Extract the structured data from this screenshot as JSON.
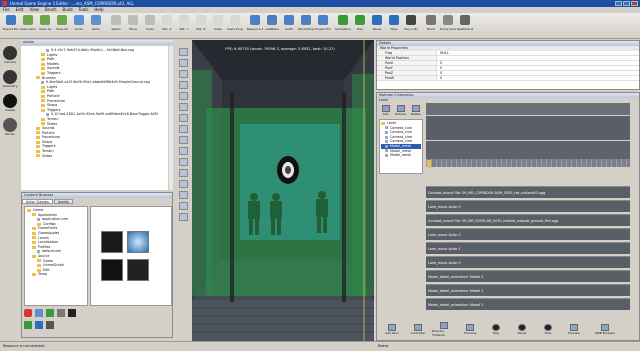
{
  "window": {
    "title": "Unreal Game Engine 3 Editor - ...vio_ASM_CORRIDOR.ut3, ALL"
  },
  "menu": [
    "File",
    "Edit",
    "View",
    "Brush",
    "Build",
    "Tools",
    "Help"
  ],
  "toolbar": [
    {
      "label": "Export Browser",
      "color": "#3f7bbf"
    },
    {
      "label": "Save Game",
      "color": "#6aa84f"
    },
    {
      "label": "Save As",
      "color": "#6aa84f"
    },
    {
      "label": "Save All",
      "color": "#6aa84f"
    },
    {
      "label": "Undo",
      "color": "#5b8fd6"
    },
    {
      "label": "Redo",
      "color": "#5b8fd6"
    },
    {
      "label": "Select",
      "color": "#bcbcbc"
    },
    {
      "label": "Move",
      "color": "#bcbcbc"
    },
    {
      "label": "Scale",
      "color": "#bcbcbc"
    },
    {
      "label": "Rot. X",
      "color": "#d8d8d8"
    },
    {
      "label": "Rot. Y",
      "color": "#d8d8d8"
    },
    {
      "label": "Rot. Z",
      "color": "#d8d8d8"
    },
    {
      "label": "Scale",
      "color": "#d8d8d8"
    },
    {
      "label": "Scale Proportional",
      "color": "#d8d8d8"
    },
    {
      "label": "Resource Browser",
      "color": "#4d7fc4"
    },
    {
      "label": "LastBake",
      "color": "#4d7fc4"
    },
    {
      "label": "AnIM",
      "color": "#4d7fc4"
    },
    {
      "label": "World Props",
      "color": "#4d7fc4"
    },
    {
      "label": "Project Props",
      "color": "#4d7fc4"
    },
    {
      "label": "Simulation",
      "color": "#3c9a3c"
    },
    {
      "label": "Play",
      "color": "#3c9a3c"
    },
    {
      "label": "Pause",
      "color": "#2c6fbf"
    },
    {
      "label": "Stop",
      "color": "#2c6fbf"
    },
    {
      "label": "Play (CE)",
      "color": "#444"
    },
    {
      "label": "Build",
      "color": "#777"
    },
    {
      "label": "Prune Scene",
      "color": "#888"
    },
    {
      "label": "Realtime Render",
      "color": "#666"
    }
  ],
  "left_icons": [
    {
      "label": "Camera",
      "color": "#333"
    },
    {
      "label": "Geometry",
      "color": "#333"
    },
    {
      "label": "Create",
      "color": "#111"
    },
    {
      "label": "Terrain",
      "color": "#555"
    }
  ],
  "actors": {
    "title": "Actors",
    "items": [
      {
        "label": "0.4 c5c7-9eb37d-4b0c-9fa4e1-...5e16b6.Box.csg",
        "kind": "file",
        "depth": 3
      },
      {
        "label": "Lights",
        "kind": "folder",
        "depth": 2
      },
      {
        "label": "Path",
        "kind": "folder",
        "depth": 2
      },
      {
        "label": "Models",
        "kind": "folder",
        "depth": 2
      },
      {
        "label": "Sounds",
        "kind": "folder",
        "depth": 2
      },
      {
        "label": "Triggers",
        "kind": "folder",
        "depth": 2
      },
      {
        "label": "Brushes",
        "kind": "folder",
        "depth": 1
      },
      {
        "label": "0.4bef4a0-a1f3-4b90-90a2-ebbe64f6b3d3.SimpleGround.csg",
        "kind": "file",
        "depth": 2
      },
      {
        "label": "Lights",
        "kind": "folder",
        "depth": 2
      },
      {
        "label": "Path",
        "kind": "folder",
        "depth": 2
      },
      {
        "label": "Particle",
        "kind": "folder",
        "depth": 2
      },
      {
        "label": "Procedural",
        "kind": "folder",
        "depth": 2
      },
      {
        "label": "Shaps",
        "kind": "folder",
        "depth": 2
      },
      {
        "label": "Triggers",
        "kind": "folder",
        "depth": 2
      },
      {
        "label": "0.10 tad-2801-1e04-95ee-9a99-ed65ebe42c6.BaseTrigger.ASM",
        "kind": "file",
        "depth": 3
      },
      {
        "label": "Terrain",
        "kind": "folder",
        "depth": 2
      },
      {
        "label": "Vistas",
        "kind": "folder",
        "depth": 2
      },
      {
        "label": "Sounds",
        "kind": "folder",
        "depth": 1
      },
      {
        "label": "Particle",
        "kind": "folder",
        "depth": 1
      },
      {
        "label": "Procedural",
        "kind": "folder",
        "depth": 1
      },
      {
        "label": "Shaps",
        "kind": "folder",
        "depth": 1
      },
      {
        "label": "Triggers",
        "kind": "folder",
        "depth": 1
      },
      {
        "label": "Terrain",
        "kind": "folder",
        "depth": 1
      },
      {
        "label": "Vistas",
        "kind": "folder",
        "depth": 1
      }
    ]
  },
  "content_browser": {
    "title": "Content Browser",
    "tabs": [
      "Actor Classes",
      "Assets"
    ],
    "items": [
      {
        "label": "Game",
        "kind": "folder",
        "depth": 0
      },
      {
        "label": "Application",
        "kind": "folder",
        "depth": 1
      },
      {
        "label": "application.xml",
        "kind": "file",
        "depth": 2
      },
      {
        "label": "Configs",
        "kind": "folder",
        "depth": 2
      },
      {
        "label": "GameFonts",
        "kind": "folder",
        "depth": 1
      },
      {
        "label": "GameApplet",
        "kind": "folder",
        "depth": 1
      },
      {
        "label": "Levels",
        "kind": "folder",
        "depth": 1
      },
      {
        "label": "Localization",
        "kind": "folder",
        "depth": 1
      },
      {
        "label": "Profiles",
        "kind": "folder",
        "depth": 1
      },
      {
        "label": "default.xml",
        "kind": "file",
        "depth": 2
      },
      {
        "label": "Source",
        "kind": "folder",
        "depth": 1
      },
      {
        "label": "Game",
        "kind": "folder",
        "depth": 2
      },
      {
        "label": "UnrealScript",
        "kind": "folder",
        "depth": 2
      },
      {
        "label": "Edit",
        "kind": "folder",
        "depth": 2
      },
      {
        "label": "Temp",
        "kind": "folder",
        "depth": 1
      }
    ]
  },
  "viewport": {
    "fps_text": "FPS: 6.90755 (worst: 79596.3, average: 5.8052, best: 10.27)"
  },
  "vertical_tools": [
    "select-tool",
    "move-tool",
    "rotate-tool",
    "scale-tool",
    "camera-tool",
    "pan-tool",
    "orbit-tool",
    "zoom-tool",
    "snap-tool",
    "grid-tool",
    "light-tool",
    "wire-tool",
    "fx-tool",
    "audio-tool",
    "path-tool",
    "hide-tool"
  ],
  "properties": {
    "title": "Details",
    "sections": [
      "World Properties"
    ],
    "rows": [
      {
        "key": "Flag",
        "value": "NULL"
      },
      {
        "key": "World Position",
        "value": ""
      },
      {
        "key": "PosX",
        "value": "0"
      },
      {
        "key": "PosY",
        "value": "0"
      },
      {
        "key": "PosZ",
        "value": "0"
      },
      {
        "key": "PosW",
        "value": "0"
      }
    ]
  },
  "sequence": {
    "title": "Matinee Cinematics",
    "tab": "Level",
    "list_buttons": [
      "Add",
      "Reload",
      "Delete"
    ],
    "list_items": [
      "Level",
      "Camera_cine",
      "Camera_cine",
      "Camera_cine",
      "Camera_cine",
      "Model_mesh",
      "Model_mesh",
      "Model_mesh"
    ],
    "tracks": [
      "Combat_sound File: 09_MR_CORRIDOR-ASM_0030_cat_surface02.ogg",
      "Lane_move Actor 0",
      "Combat_sound File: 09_MR_DOOR-AR_0030_missile_outpost_ground_fire.ogg",
      "Lane_move Actor 0",
      "Lane_move Actor 1",
      "Lane_move Actor 0",
      "Model_dekel_animation: Model 0",
      "Model_dekel_animation: Model 1",
      "Model_dekel_animation: Model 2"
    ],
    "bottom_buttons": [
      "Add Item",
      "Controller",
      "Director Timeline",
      "Timeline",
      "Play",
      "Pause",
      "Stop",
      "Preview",
      "WPB Browser"
    ]
  },
  "status": {
    "text": "Resource is not selected.",
    "right": "Ready"
  },
  "colors": {
    "accent": "#1c4ea4",
    "viewport_bg": "#2d3138",
    "green_volume": "#2e8a4a",
    "teal_volume": "#2fa59a"
  }
}
